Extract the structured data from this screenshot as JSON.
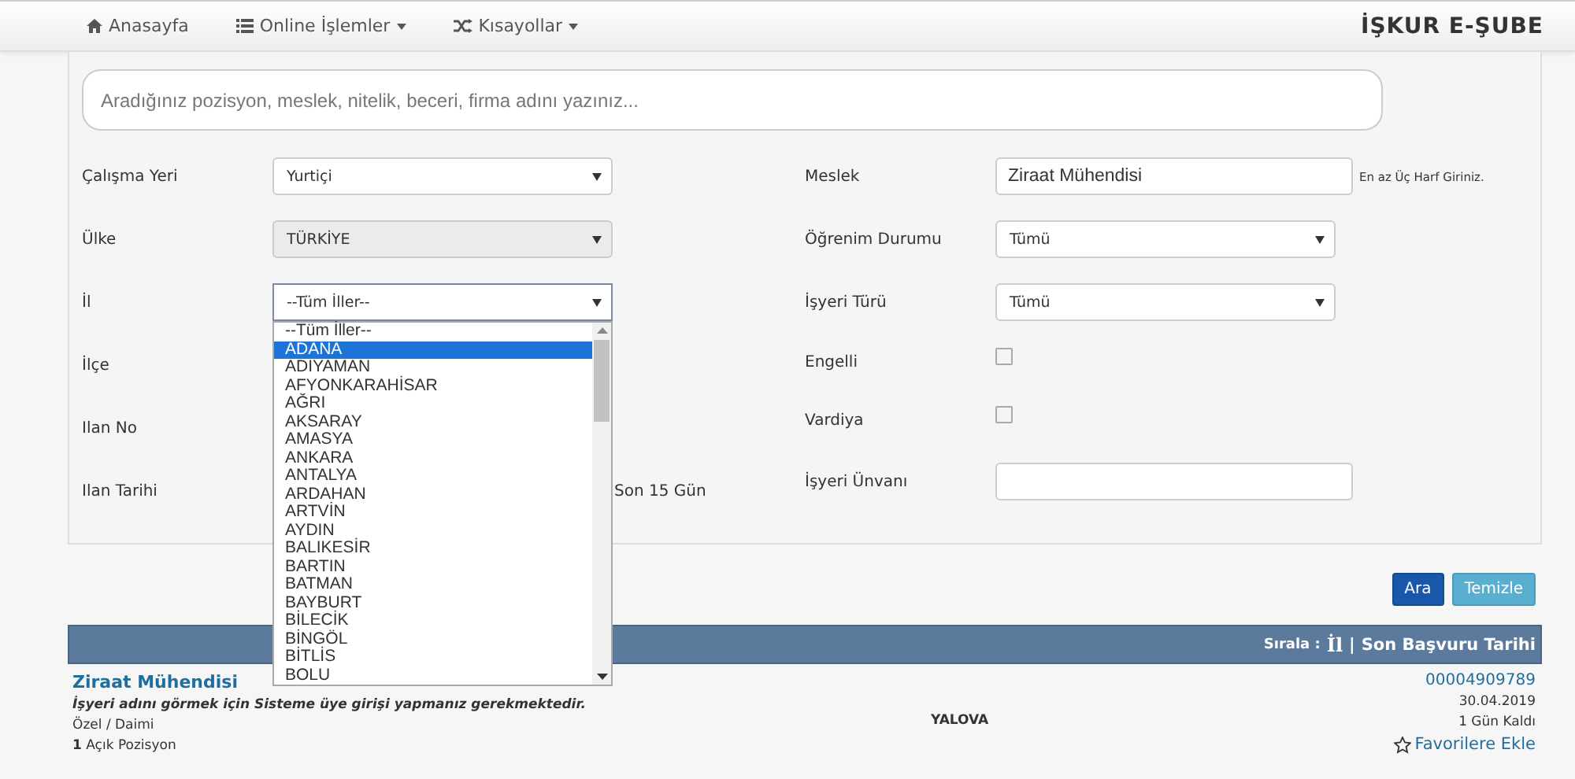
{
  "navbar": {
    "items": [
      {
        "label": "Anasayfa",
        "kind": "home",
        "has_menu": false
      },
      {
        "label": "Online İşlemler",
        "kind": "list",
        "has_menu": true
      },
      {
        "label": "Kısayollar",
        "kind": "shuffle",
        "has_menu": true
      }
    ],
    "brand": "İŞKUR E-ŞUBE"
  },
  "search": {
    "placeholder": "Aradığınız pozisyon, meslek, nitelik, beceri, firma adını yazınız..."
  },
  "filters_left": [
    {
      "label": "Çalışma Yeri",
      "kind": "select",
      "value": "Yurtiçi",
      "disabled": false
    },
    {
      "label": "Ülke",
      "kind": "select",
      "value": "TÜRKİYE",
      "disabled": true
    },
    {
      "label": "İl",
      "kind": "select",
      "value": "--Tüm İller--",
      "disabled": false,
      "open": true
    },
    {
      "label": "İlçe",
      "kind": "covered"
    },
    {
      "label": "Ilan No",
      "kind": "covered"
    },
    {
      "label": "Ilan Tarihi",
      "kind": "note",
      "note": "Son 15 Gün"
    }
  ],
  "filters_right": [
    {
      "label": "Meslek",
      "kind": "input",
      "value": "Ziraat Mühendisi",
      "hint": "En az Üç Harf Giriniz."
    },
    {
      "label": "Öğrenim Durumu",
      "kind": "select",
      "value": "Tümü",
      "disabled": false
    },
    {
      "label": "İşyeri Türü",
      "kind": "select",
      "value": "Tümü",
      "disabled": false
    },
    {
      "label": "Engelli",
      "kind": "checkbox",
      "checked": false
    },
    {
      "label": "Vardiya",
      "kind": "checkbox",
      "checked": false
    },
    {
      "label": "İşyeri Ünvanı",
      "kind": "input"
    }
  ],
  "dropdown": {
    "options": [
      {
        "label": "--Tüm İller--",
        "selected": false
      },
      {
        "label": "ADANA",
        "selected": true
      },
      {
        "label": "ADIYAMAN",
        "selected": false
      },
      {
        "label": "AFYONKARAHİSAR",
        "selected": false
      },
      {
        "label": "AĞRI",
        "selected": false
      },
      {
        "label": "AKSARAY",
        "selected": false
      },
      {
        "label": "AMASYA",
        "selected": false
      },
      {
        "label": "ANKARA",
        "selected": false
      },
      {
        "label": "ANTALYA",
        "selected": false
      },
      {
        "label": "ARDAHAN",
        "selected": false
      },
      {
        "label": "ARTVİN",
        "selected": false
      },
      {
        "label": "AYDIN",
        "selected": false
      },
      {
        "label": "BALIKESİR",
        "selected": false
      },
      {
        "label": "BARTIN",
        "selected": false
      },
      {
        "label": "BATMAN",
        "selected": false
      },
      {
        "label": "BAYBURT",
        "selected": false
      },
      {
        "label": "BİLECİK",
        "selected": false
      },
      {
        "label": "BİNGÖL",
        "selected": false
      },
      {
        "label": "BİTLİS",
        "selected": false
      },
      {
        "label": "BOLU",
        "selected": false
      }
    ]
  },
  "buttons": [
    {
      "label": "Ara",
      "kind": "primary"
    },
    {
      "label": "Temizle",
      "kind": "info"
    }
  ],
  "results_header": {
    "sort_label": "Sırala :",
    "sort_options": [
      "İl",
      "Son Başvuru Tarihi"
    ],
    "separator": "|"
  },
  "results": [
    {
      "title": "Ziraat Mühendisi",
      "notice": "İşyeri adını görmek için Sisteme üye girişi yapmanız gerekmektedir.",
      "type": "Özel / Daimi",
      "positions_count": "1",
      "positions_label": "Açık Pozisyon",
      "city": "YALOVA",
      "ad_no": "00004909789",
      "date": "30.04.2019",
      "remaining": "1 Gün Kaldı",
      "favorite": "Favorilere Ekle"
    }
  ]
}
